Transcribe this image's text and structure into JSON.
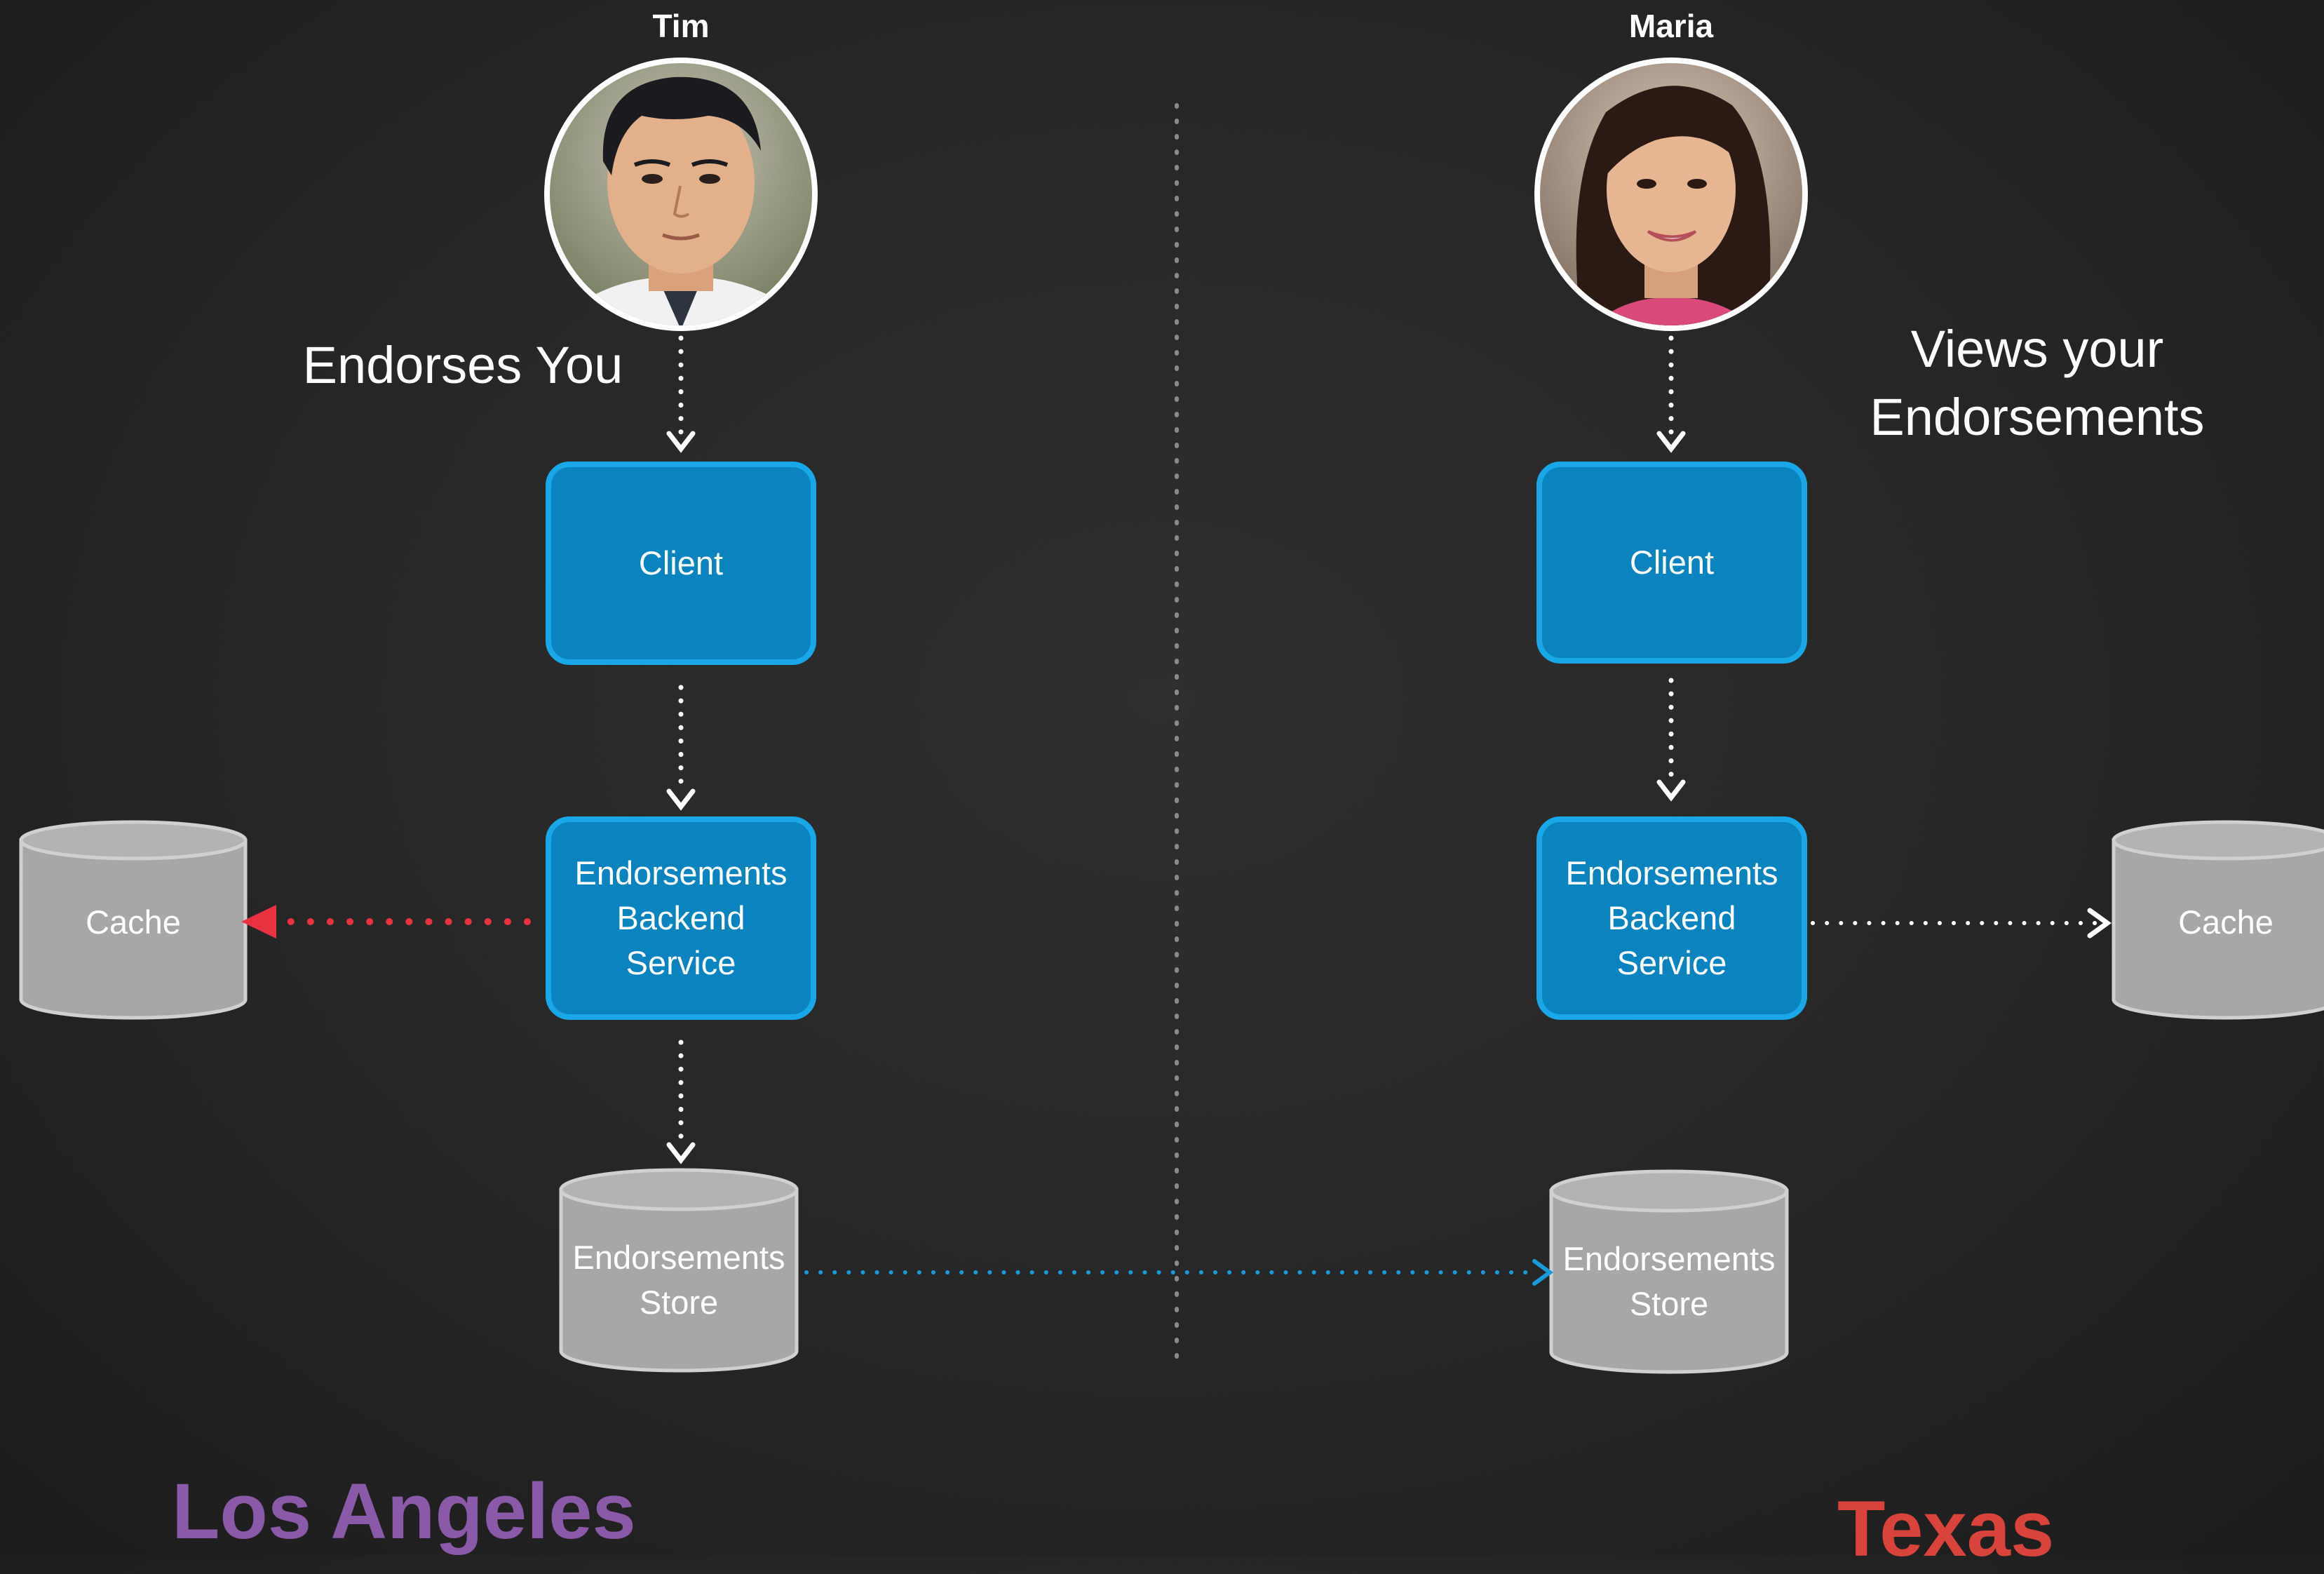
{
  "people": {
    "left": {
      "name": "Tim",
      "action": "Endorses You"
    },
    "right": {
      "name": "Maria",
      "action_line1": "Views your",
      "action_line2": "Endorsements"
    }
  },
  "nodes": {
    "left_client": "Client",
    "left_backend": [
      "Endorsements",
      "Backend",
      "Service"
    ],
    "left_cache": "Cache",
    "left_store": [
      "Endorsements",
      "Store"
    ],
    "right_client": "Client",
    "right_backend": [
      "Endorsements",
      "Backend",
      "Service"
    ],
    "right_cache": "Cache",
    "right_store": [
      "Endorsements",
      "Store"
    ]
  },
  "regions": {
    "left": "Los Angeles",
    "right": "Texas"
  },
  "colors": {
    "node_blue": "#0a83be",
    "node_border": "#1aa7e8",
    "db_gray": "#a7a7a7",
    "replication_arrow": "#1a9ad8",
    "cache_write_arrow": "#e8323f",
    "region_left": "#8a5aa8",
    "region_right": "#d8433b"
  }
}
